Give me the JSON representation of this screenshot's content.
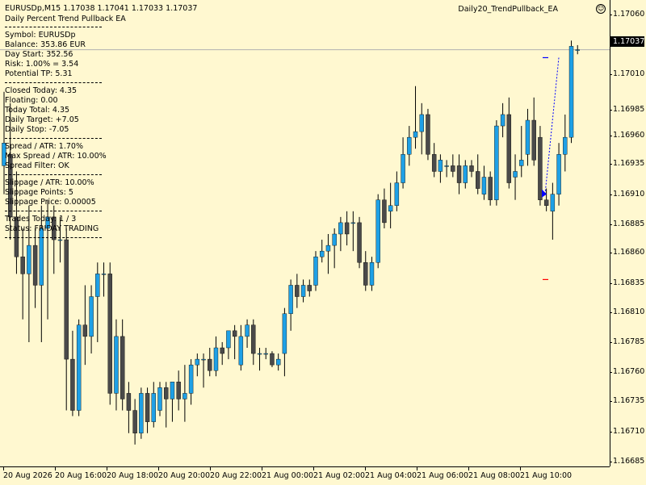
{
  "header": {
    "symbol_line": "EURUSDp,M15  1.17038 1.17041 1.17033 1.17037",
    "ea_name": "Daily Percent Trend Pullback EA",
    "ea_label": "Daily20_TrendPullback_EA",
    "smiley_icon": "smiley-face-icon"
  },
  "info_panel": {
    "blocks": [
      [
        "Symbol: EURUSDp",
        "Balance: 353.86 EUR",
        "Day Start: 352.56",
        "Risk: 1.00% = 3.54",
        "Potential TP: 5.31"
      ],
      [
        "Closed Today: 4.35",
        "Floating: 0.00",
        "Today Total: 4.35",
        "Daily Target: +7.05",
        "Daily Stop: -7.05"
      ],
      [
        "Spread / ATR: 1.70%",
        "Max Spread / ATR: 10.00%",
        "Spread Filter: OK"
      ],
      [
        "Slippage / ATR: 10.00%",
        "Slippage Points: 5",
        "Slippage Price: 0.00005"
      ],
      [
        "Trades Today: 1 / 3",
        "Status: FRIDAY TRADING"
      ]
    ]
  },
  "price_axis": {
    "ticks": [
      "1.17060",
      "1.17037",
      "1.17010",
      "1.16985",
      "1.16960",
      "1.16935",
      "1.16910",
      "1.16885",
      "1.16860",
      "1.16835",
      "1.16810",
      "1.16785",
      "1.16760",
      "1.16735",
      "1.16710",
      "1.16685"
    ],
    "current_price": "1.17037"
  },
  "time_axis": {
    "ticks": [
      "20 Aug 2026",
      "20 Aug 16:00",
      "20 Aug 18:00",
      "20 Aug 20:00",
      "20 Aug 22:00",
      "21 Aug 00:00",
      "21 Aug 02:00",
      "21 Aug 04:00",
      "21 Aug 06:00",
      "21 Aug 08:00",
      "21 Aug 10:00"
    ]
  },
  "colors": {
    "background": "#fff8d0",
    "bull": "#1ea0e6",
    "bear": "#4a4a4a",
    "wick": "#000000",
    "current_price_line": "#b0b0b0",
    "entry_arrow": "#0000ff",
    "sl_marker": "#ff0000",
    "tp_marker": "#0000ff"
  },
  "chart_data": {
    "type": "candlestick",
    "symbol": "EURUSDp",
    "timeframe": "M15",
    "ylim": [
      1.16675,
      1.17075
    ],
    "candles": [
      {
        "o": 1.16935,
        "h": 1.17,
        "l": 1.1691,
        "c": 1.16955
      },
      {
        "o": 1.16945,
        "h": 1.1699,
        "l": 1.1687,
        "c": 1.1689
      },
      {
        "o": 1.1689,
        "h": 1.1693,
        "l": 1.1684,
        "c": 1.16855
      },
      {
        "o": 1.16855,
        "h": 1.1688,
        "l": 1.168,
        "c": 1.1684
      },
      {
        "o": 1.1684,
        "h": 1.169,
        "l": 1.1678,
        "c": 1.16865
      },
      {
        "o": 1.16865,
        "h": 1.1688,
        "l": 1.1681,
        "c": 1.1683
      },
      {
        "o": 1.1683,
        "h": 1.169,
        "l": 1.1678,
        "c": 1.1688
      },
      {
        "o": 1.1688,
        "h": 1.16905,
        "l": 1.168,
        "c": 1.1689
      },
      {
        "o": 1.1689,
        "h": 1.169,
        "l": 1.1684,
        "c": 1.1687
      },
      {
        "o": 1.1687,
        "h": 1.1689,
        "l": 1.1685,
        "c": 1.1687
      },
      {
        "o": 1.1687,
        "h": 1.1688,
        "l": 1.1672,
        "c": 1.16765
      },
      {
        "o": 1.16765,
        "h": 1.1679,
        "l": 1.16715,
        "c": 1.1672
      },
      {
        "o": 1.1672,
        "h": 1.168,
        "l": 1.16715,
        "c": 1.16795
      },
      {
        "o": 1.16795,
        "h": 1.1683,
        "l": 1.1676,
        "c": 1.16785
      },
      {
        "o": 1.16785,
        "h": 1.1683,
        "l": 1.1677,
        "c": 1.1682
      },
      {
        "o": 1.1682,
        "h": 1.1685,
        "l": 1.1678,
        "c": 1.1684
      },
      {
        "o": 1.1684,
        "h": 1.1685,
        "l": 1.1682,
        "c": 1.1684
      },
      {
        "o": 1.1684,
        "h": 1.1685,
        "l": 1.16725,
        "c": 1.16735
      },
      {
        "o": 1.16735,
        "h": 1.168,
        "l": 1.1672,
        "c": 1.16785
      },
      {
        "o": 1.16785,
        "h": 1.168,
        "l": 1.1672,
        "c": 1.1673
      },
      {
        "o": 1.16735,
        "h": 1.16745,
        "l": 1.167,
        "c": 1.1672
      },
      {
        "o": 1.1672,
        "h": 1.1673,
        "l": 1.1669,
        "c": 1.167
      },
      {
        "o": 1.167,
        "h": 1.1674,
        "l": 1.16695,
        "c": 1.16735
      },
      {
        "o": 1.16735,
        "h": 1.1674,
        "l": 1.167,
        "c": 1.1671
      },
      {
        "o": 1.1671,
        "h": 1.16745,
        "l": 1.16705,
        "c": 1.16735
      },
      {
        "o": 1.1672,
        "h": 1.16745,
        "l": 1.16715,
        "c": 1.1674
      },
      {
        "o": 1.1674,
        "h": 1.16745,
        "l": 1.16705,
        "c": 1.1673
      },
      {
        "o": 1.1673,
        "h": 1.16745,
        "l": 1.1671,
        "c": 1.16745
      },
      {
        "o": 1.16745,
        "h": 1.16755,
        "l": 1.1672,
        "c": 1.1673
      },
      {
        "o": 1.1673,
        "h": 1.1676,
        "l": 1.1671,
        "c": 1.16735
      },
      {
        "o": 1.16735,
        "h": 1.16765,
        "l": 1.16725,
        "c": 1.1676
      },
      {
        "o": 1.1676,
        "h": 1.1677,
        "l": 1.1675,
        "c": 1.16765
      },
      {
        "o": 1.16765,
        "h": 1.1677,
        "l": 1.1674,
        "c": 1.16765
      },
      {
        "o": 1.16765,
        "h": 1.16775,
        "l": 1.1675,
        "c": 1.16755
      },
      {
        "o": 1.16755,
        "h": 1.16785,
        "l": 1.1675,
        "c": 1.16775
      },
      {
        "o": 1.16775,
        "h": 1.1678,
        "l": 1.1676,
        "c": 1.1677
      },
      {
        "o": 1.16775,
        "h": 1.16785,
        "l": 1.16765,
        "c": 1.1679
      },
      {
        "o": 1.1679,
        "h": 1.16795,
        "l": 1.16765,
        "c": 1.16785
      },
      {
        "o": 1.1676,
        "h": 1.16795,
        "l": 1.16755,
        "c": 1.16785
      },
      {
        "o": 1.16785,
        "h": 1.168,
        "l": 1.16775,
        "c": 1.16795
      },
      {
        "o": 1.16795,
        "h": 1.168,
        "l": 1.1676,
        "c": 1.1677
      },
      {
        "o": 1.1677,
        "h": 1.16775,
        "l": 1.16755,
        "c": 1.1677
      },
      {
        "o": 1.1677,
        "h": 1.16775,
        "l": 1.16765,
        "c": 1.1677
      },
      {
        "o": 1.1677,
        "h": 1.16772,
        "l": 1.16758,
        "c": 1.1676
      },
      {
        "o": 1.1676,
        "h": 1.1677,
        "l": 1.16755,
        "c": 1.16765
      },
      {
        "o": 1.1677,
        "h": 1.1681,
        "l": 1.1675,
        "c": 1.16805
      },
      {
        "o": 1.16805,
        "h": 1.16835,
        "l": 1.1679,
        "c": 1.1683
      },
      {
        "o": 1.1683,
        "h": 1.1684,
        "l": 1.1681,
        "c": 1.1682
      },
      {
        "o": 1.1682,
        "h": 1.16835,
        "l": 1.16815,
        "c": 1.1683
      },
      {
        "o": 1.1683,
        "h": 1.16835,
        "l": 1.1682,
        "c": 1.16825
      },
      {
        "o": 1.1683,
        "h": 1.1686,
        "l": 1.16825,
        "c": 1.16855
      },
      {
        "o": 1.16855,
        "h": 1.1687,
        "l": 1.1685,
        "c": 1.1686
      },
      {
        "o": 1.1686,
        "h": 1.16875,
        "l": 1.1684,
        "c": 1.16865
      },
      {
        "o": 1.16865,
        "h": 1.1688,
        "l": 1.16845,
        "c": 1.16875
      },
      {
        "o": 1.16875,
        "h": 1.1689,
        "l": 1.1686,
        "c": 1.16885
      },
      {
        "o": 1.16885,
        "h": 1.16895,
        "l": 1.16865,
        "c": 1.16875
      },
      {
        "o": 1.16885,
        "h": 1.16895,
        "l": 1.1686,
        "c": 1.16885
      },
      {
        "o": 1.16885,
        "h": 1.1689,
        "l": 1.16845,
        "c": 1.1685
      },
      {
        "o": 1.1685,
        "h": 1.1686,
        "l": 1.16825,
        "c": 1.1683
      },
      {
        "o": 1.1683,
        "h": 1.16855,
        "l": 1.16825,
        "c": 1.1685
      },
      {
        "o": 1.1685,
        "h": 1.1691,
        "l": 1.16845,
        "c": 1.16905
      },
      {
        "o": 1.16905,
        "h": 1.16915,
        "l": 1.1688,
        "c": 1.16885
      },
      {
        "o": 1.16895,
        "h": 1.1692,
        "l": 1.1688,
        "c": 1.169
      },
      {
        "o": 1.169,
        "h": 1.1693,
        "l": 1.16895,
        "c": 1.1692
      },
      {
        "o": 1.1692,
        "h": 1.1696,
        "l": 1.16915,
        "c": 1.16945
      },
      {
        "o": 1.16945,
        "h": 1.1697,
        "l": 1.16935,
        "c": 1.1696
      },
      {
        "o": 1.1696,
        "h": 1.17005,
        "l": 1.1695,
        "c": 1.16965
      },
      {
        "o": 1.16965,
        "h": 1.1699,
        "l": 1.16945,
        "c": 1.1698
      },
      {
        "o": 1.1698,
        "h": 1.16985,
        "l": 1.1694,
        "c": 1.16945
      },
      {
        "o": 1.16945,
        "h": 1.16955,
        "l": 1.16925,
        "c": 1.1693
      },
      {
        "o": 1.1693,
        "h": 1.16945,
        "l": 1.1692,
        "c": 1.1694
      },
      {
        "o": 1.16935,
        "h": 1.1694,
        "l": 1.16925,
        "c": 1.16935
      },
      {
        "o": 1.16935,
        "h": 1.16945,
        "l": 1.16925,
        "c": 1.1693
      },
      {
        "o": 1.16935,
        "h": 1.16945,
        "l": 1.1691,
        "c": 1.1692
      },
      {
        "o": 1.1692,
        "h": 1.1694,
        "l": 1.16915,
        "c": 1.16935
      },
      {
        "o": 1.16935,
        "h": 1.1694,
        "l": 1.16925,
        "c": 1.1693
      },
      {
        "o": 1.1693,
        "h": 1.16945,
        "l": 1.1691,
        "c": 1.16915
      },
      {
        "o": 1.1691,
        "h": 1.16935,
        "l": 1.16905,
        "c": 1.16925
      },
      {
        "o": 1.16925,
        "h": 1.1693,
        "l": 1.169,
        "c": 1.16905
      },
      {
        "o": 1.16905,
        "h": 1.16975,
        "l": 1.169,
        "c": 1.1697
      },
      {
        "o": 1.1697,
        "h": 1.1699,
        "l": 1.1696,
        "c": 1.1698
      },
      {
        "o": 1.1698,
        "h": 1.16995,
        "l": 1.16915,
        "c": 1.1692
      },
      {
        "o": 1.16925,
        "h": 1.16945,
        "l": 1.16905,
        "c": 1.1693
      },
      {
        "o": 1.16935,
        "h": 1.1697,
        "l": 1.16925,
        "c": 1.1694
      },
      {
        "o": 1.16945,
        "h": 1.16985,
        "l": 1.16935,
        "c": 1.16975
      },
      {
        "o": 1.16975,
        "h": 1.16995,
        "l": 1.16935,
        "c": 1.1694
      },
      {
        "o": 1.1696,
        "h": 1.1697,
        "l": 1.169,
        "c": 1.16905
      },
      {
        "o": 1.16905,
        "h": 1.16915,
        "l": 1.16895,
        "c": 1.169
      },
      {
        "o": 1.16895,
        "h": 1.1692,
        "l": 1.1687,
        "c": 1.1691
      },
      {
        "o": 1.1691,
        "h": 1.16955,
        "l": 1.169,
        "c": 1.16945
      },
      {
        "o": 1.16945,
        "h": 1.1698,
        "l": 1.1693,
        "c": 1.1696
      },
      {
        "o": 1.1696,
        "h": 1.17045,
        "l": 1.16955,
        "c": 1.1704
      },
      {
        "o": 1.17037,
        "h": 1.17041,
        "l": 1.17033,
        "c": 1.17037
      }
    ],
    "current_price_line": 1.17037,
    "markers": [
      {
        "kind": "tp",
        "price": 1.1703
      },
      {
        "kind": "sl",
        "price": 1.16835
      },
      {
        "kind": "entry-arrow",
        "price": 1.1691
      }
    ]
  }
}
